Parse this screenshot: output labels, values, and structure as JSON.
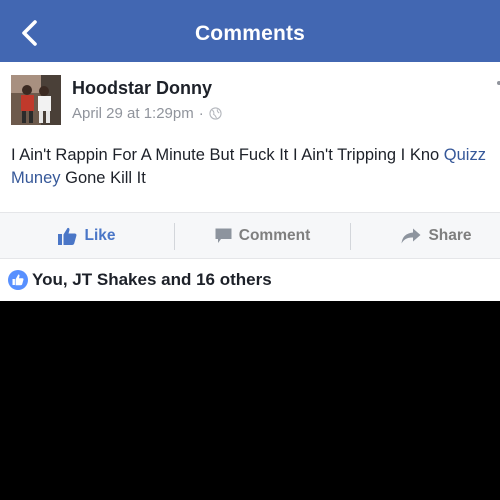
{
  "header": {
    "title": "Comments"
  },
  "post": {
    "author": "Hoodstar Donny",
    "date": "April 29 at 1:29pm",
    "separator": "·",
    "text_before": "I Ain't Rappin For A Minute But Fuck It I Ain't Tripping I Kno",
    "mention": "Quizz Muney",
    "text_after": " Gone Kill It"
  },
  "actions": {
    "like_label": "Like",
    "comment_label": "Comment",
    "share_label": "Share"
  },
  "reactions": {
    "summary": "You, JT Shakes and 16 others"
  },
  "colors": {
    "header_bg": "#4267b2",
    "link_blue": "#365899",
    "like_blue": "#4a76c7",
    "action_gray": "#7f7f7f",
    "action_bar_bg": "#f6f7f9"
  },
  "icons": {
    "back": "chevron-left-icon",
    "privacy": "globe-icon",
    "like": "thumbs-up-icon",
    "comment": "speech-bubble-icon",
    "share": "share-arrow-icon",
    "reaction": "like-badge-icon"
  }
}
